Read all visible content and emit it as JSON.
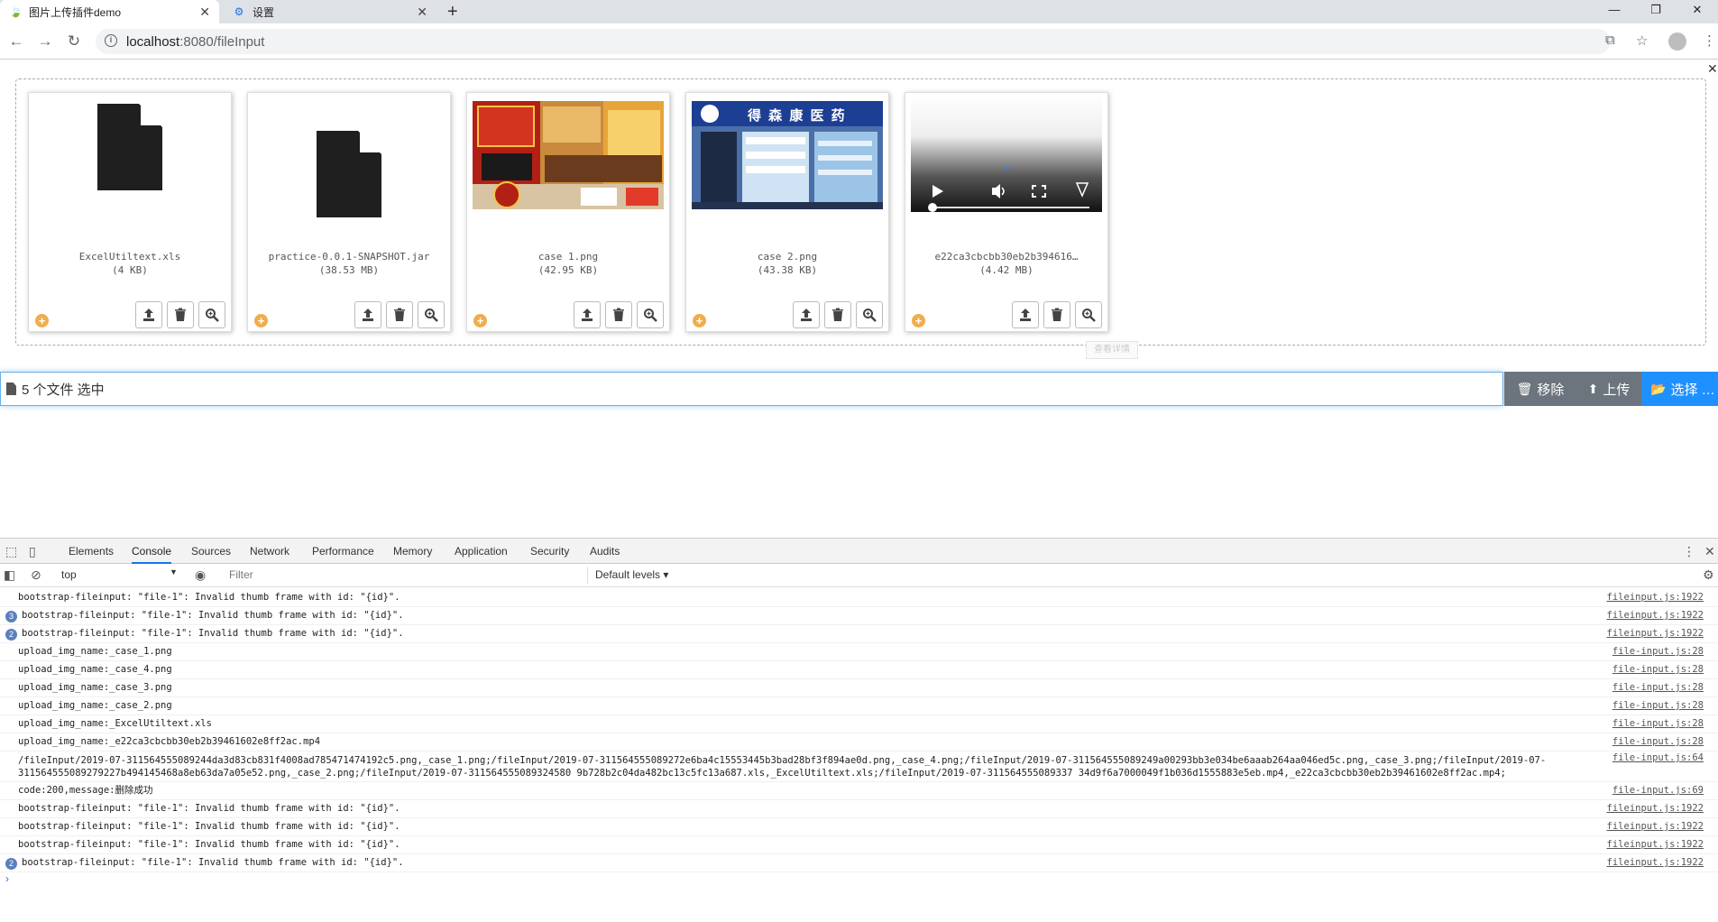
{
  "browser": {
    "tabs": [
      {
        "title": "图片上传插件demo",
        "icon": "leaf-icon"
      },
      {
        "title": "设置",
        "icon": "gear-icon"
      }
    ],
    "url_host": "localhost",
    "url_path": ":8080/fileInput"
  },
  "files": [
    {
      "name": "ExcelUtiltext.xls",
      "size": "(4 KB)",
      "kind": "file"
    },
    {
      "name": "practice-0.0.1-SNAPSHOT.jar",
      "size": "(38.53 MB)",
      "kind": "file"
    },
    {
      "name": "case 1.png",
      "size": "(42.95 KB)",
      "kind": "image"
    },
    {
      "name": "case 2.png",
      "size": "(43.38 KB)",
      "kind": "image"
    },
    {
      "name": "e22ca3cbcbb30eb2b394616…",
      "size": "(4.42 MB)",
      "kind": "video"
    }
  ],
  "img_sign": "得 森 康 医 药",
  "fileinput": {
    "caption": "5 个文件 选中",
    "remove_label": "移除",
    "upload_label": "上传",
    "select_label": "选择 …"
  },
  "tooltip_ghost": "查看详情",
  "devtools": {
    "tabs": [
      "Elements",
      "Console",
      "Sources",
      "Network",
      "Performance",
      "Memory",
      "Application",
      "Security",
      "Audits"
    ],
    "active_tab": "Console",
    "context": "top",
    "filter_placeholder": "Filter",
    "levels": "Default levels ▾",
    "logs": [
      {
        "badge": "",
        "msg": "bootstrap-fileinput: \"file-1\": Invalid thumb frame with id: \"{id}\".",
        "src": "fileinput.js:1922"
      },
      {
        "badge": "3",
        "msg": "bootstrap-fileinput: \"file-1\": Invalid thumb frame with id: \"{id}\".",
        "src": "fileinput.js:1922"
      },
      {
        "badge": "2",
        "msg": "bootstrap-fileinput: \"file-1\": Invalid thumb frame with id: \"{id}\".",
        "src": "fileinput.js:1922"
      },
      {
        "badge": "",
        "msg": "upload_img_name:_case_1.png",
        "src": "file-input.js:28"
      },
      {
        "badge": "",
        "msg": "upload_img_name:_case_4.png",
        "src": "file-input.js:28"
      },
      {
        "badge": "",
        "msg": "upload_img_name:_case_3.png",
        "src": "file-input.js:28"
      },
      {
        "badge": "",
        "msg": "upload_img_name:_case_2.png",
        "src": "file-input.js:28"
      },
      {
        "badge": "",
        "msg": "upload_img_name:_ExcelUtiltext.xls",
        "src": "file-input.js:28"
      },
      {
        "badge": "",
        "msg": "upload_img_name:_e22ca3cbcbb30eb2b39461602e8ff2ac.mp4",
        "src": "file-input.js:28"
      },
      {
        "badge": "",
        "tall": true,
        "msg": "/fileInput/2019-07-311564555089244da3d83cb831f4008ad785471474192c5.png,_case_1.png;/fileInput/2019-07-311564555089272e6ba4c15553445b3bad28bf3f894ae0d.png,_case_4.png;/fileInput/2019-07-311564555089249a00293bb3e034be6aaab264aa046ed5c.png,_case_3.png;/fileInput/2019-07-311564555089279227b494145468a8eb63da7a05e52.png,_case_2.png;/fileInput/2019-07-311564555089324580 9b728b2c04da482bc13c5fc13a687.xls,_ExcelUtiltext.xls;/fileInput/2019-07-311564555089337 34d9f6a7000049f1b036d1555883e5eb.mp4,_e22ca3cbcbb30eb2b39461602e8ff2ac.mp4;",
        "src": "file-input.js:64"
      },
      {
        "badge": "",
        "msg": "code:200,message:删除成功",
        "src": "file-input.js:69"
      },
      {
        "badge": "",
        "msg": "bootstrap-fileinput: \"file-1\": Invalid thumb frame with id: \"{id}\".",
        "src": "fileinput.js:1922"
      },
      {
        "badge": "",
        "msg": "bootstrap-fileinput: \"file-1\": Invalid thumb frame with id: \"{id}\".",
        "src": "fileinput.js:1922"
      },
      {
        "badge": "",
        "msg": "bootstrap-fileinput: \"file-1\": Invalid thumb frame with id: \"{id}\".",
        "src": "fileinput.js:1922"
      },
      {
        "badge": "2",
        "msg": "bootstrap-fileinput: \"file-1\": Invalid thumb frame with id: \"{id}\".",
        "src": "fileinput.js:1922"
      }
    ]
  },
  "colors": {
    "primary": "#1e90ff",
    "secondary": "#6c757d",
    "status_pending": "#f0ad4e"
  }
}
